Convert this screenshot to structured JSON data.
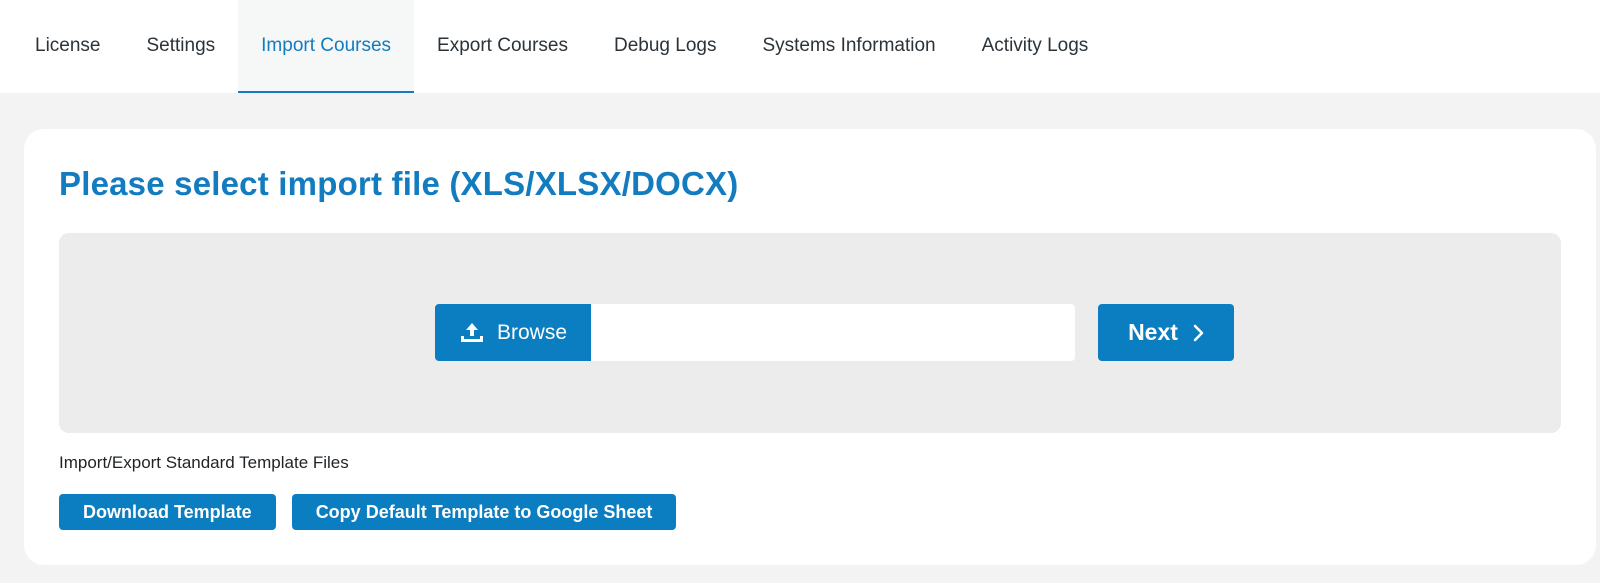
{
  "tabs": [
    {
      "label": "License",
      "active": false
    },
    {
      "label": "Settings",
      "active": false
    },
    {
      "label": "Import Courses",
      "active": true
    },
    {
      "label": "Export Courses",
      "active": false
    },
    {
      "label": "Debug Logs",
      "active": false
    },
    {
      "label": "Systems Information",
      "active": false
    },
    {
      "label": "Activity Logs",
      "active": false
    }
  ],
  "import": {
    "title": "Please select import file (XLS/XLSX/DOCX)",
    "browse_label": "Browse",
    "browse_icon": "upload-icon",
    "file_value": "",
    "next_label": "Next",
    "next_icon": "chevron-right-icon"
  },
  "templates": {
    "label": "Import/Export Standard Template Files",
    "download_label": "Download Template",
    "google_sheet_label": "Copy Default Template to Google Sheet"
  },
  "colors": {
    "accent": "#0b7dc1",
    "title": "#137cc0",
    "background": "#f3f3f3",
    "dropzone": "#ececec"
  }
}
